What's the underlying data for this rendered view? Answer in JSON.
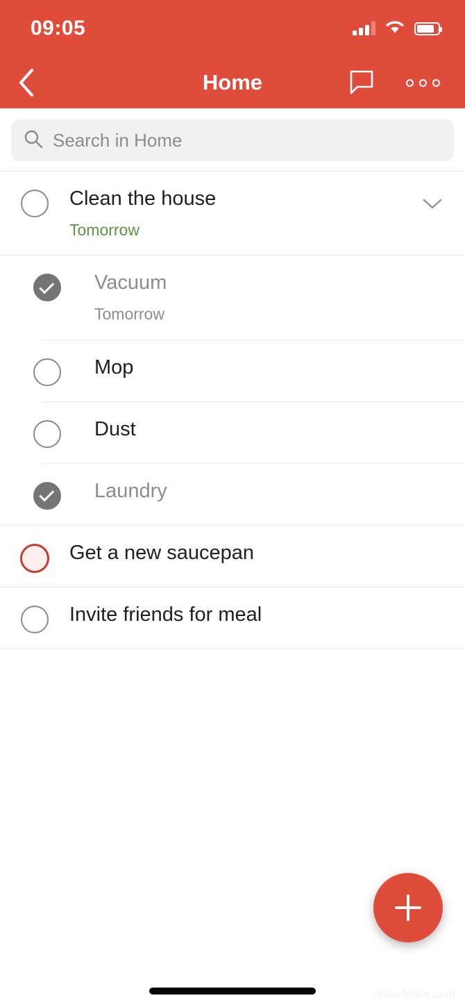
{
  "status_bar": {
    "time": "09:05",
    "signal_icon": "cellular-signal-icon",
    "wifi_icon": "wifi-icon",
    "battery_icon": "battery-icon"
  },
  "nav_bar": {
    "back_icon": "chevron-left-icon",
    "title": "Home",
    "comment_icon": "comment-bubble-icon",
    "more_icon": "more-options-icon"
  },
  "search": {
    "icon": "search-icon",
    "placeholder": "Search in Home",
    "value": ""
  },
  "tasks": [
    {
      "title": "Clean the house",
      "subtitle": "Tomorrow",
      "subtitle_color": "#5E9142",
      "checked": false,
      "priority": false,
      "level": "top",
      "expand_icon": "chevron-down-icon",
      "expanded": true
    },
    {
      "title": "Vacuum",
      "subtitle": "Tomorrow",
      "subtitle_color": "#8C8C8C",
      "checked": true,
      "priority": false,
      "level": "sub"
    },
    {
      "title": "Mop",
      "subtitle": "",
      "checked": false,
      "priority": false,
      "level": "sub"
    },
    {
      "title": "Dust",
      "subtitle": "",
      "checked": false,
      "priority": false,
      "level": "sub"
    },
    {
      "title": "Laundry",
      "subtitle": "",
      "checked": true,
      "priority": false,
      "level": "sub"
    },
    {
      "title": "Get a new saucepan",
      "subtitle": "",
      "checked": false,
      "priority": true,
      "level": "top"
    },
    {
      "title": "Invite friends for meal",
      "subtitle": "",
      "checked": false,
      "priority": false,
      "level": "top"
    }
  ],
  "fab": {
    "icon": "plus-icon",
    "label": "+"
  },
  "footer": {
    "watermark": "www.frfam.com"
  },
  "colors": {
    "accent": "#E04C3C",
    "priority": "#C53A2E",
    "checked": "#757575",
    "due_green": "#5E9142",
    "search_bg": "#F1F1F1"
  }
}
